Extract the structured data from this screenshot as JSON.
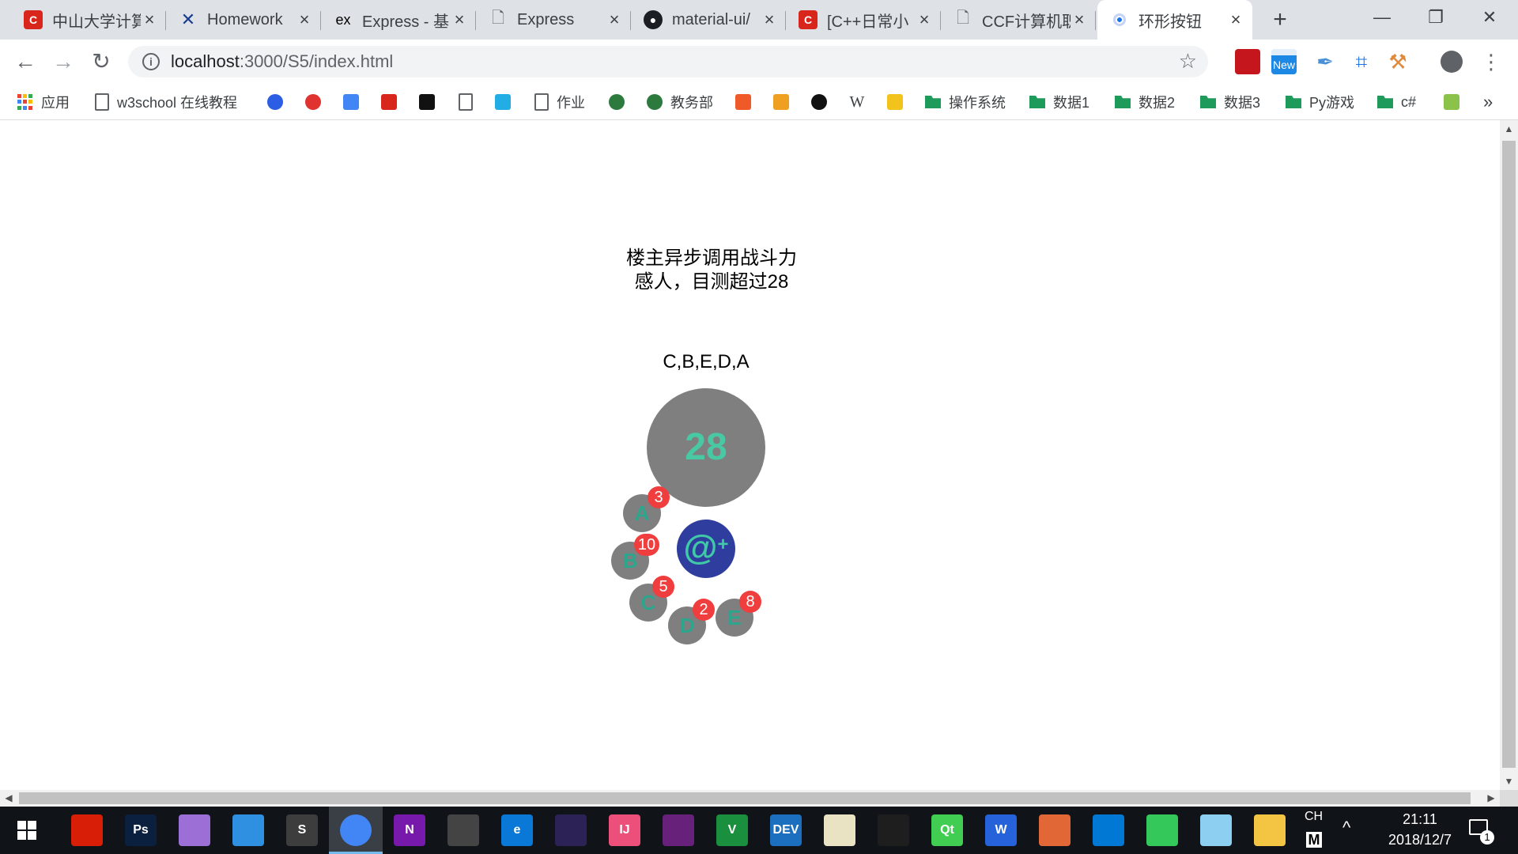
{
  "browser": {
    "tabs": [
      {
        "title": "中山大学计算",
        "icon": "csdn-icon",
        "active": false
      },
      {
        "title": "Homework",
        "icon": "x-logo-icon",
        "active": false
      },
      {
        "title": "Express - 基",
        "icon": "express-icon",
        "active": false
      },
      {
        "title": "Express",
        "icon": "document-icon",
        "active": false
      },
      {
        "title": "material-ui/",
        "icon": "github-icon",
        "active": false
      },
      {
        "title": "[C++日常小",
        "icon": "csdn-icon",
        "active": false
      },
      {
        "title": "CCF计算机职",
        "icon": "document-icon",
        "active": false
      },
      {
        "title": "环形按钮",
        "icon": "loading-dot-icon",
        "active": true
      }
    ],
    "new_tab": "+",
    "window_controls": {
      "minimize": "—",
      "restore": "❐",
      "close": "✕"
    },
    "address": {
      "host": "localhost",
      "rest": ":3000/S5/index.html"
    },
    "extensions": [
      {
        "name": "pdf-extension-icon",
        "color": "#c4161c"
      },
      {
        "name": "new-badge-extension-icon",
        "label": "New",
        "color": "#1e88e5"
      },
      {
        "name": "eyedropper-extension-icon",
        "color": "#4a90d9"
      },
      {
        "name": "crop-extension-icon",
        "color": "#1a73e8"
      },
      {
        "name": "tool-extension-icon",
        "color": "#e0893a"
      },
      {
        "name": "account-icon",
        "color": "#5f6368"
      },
      {
        "name": "menu-icon",
        "color": "#5f6368"
      }
    ],
    "bookmarks": [
      {
        "label": "应用",
        "icon": "apps-icon"
      },
      {
        "label": "w3school 在线教程",
        "icon": "document-icon"
      },
      {
        "label": "",
        "icon": "baidu-icon",
        "color": "#2b5ee5"
      },
      {
        "label": "",
        "icon": "weibo-icon",
        "color": "#e0322e"
      },
      {
        "label": "",
        "icon": "translate-icon",
        "color": "#4285f4"
      },
      {
        "label": "",
        "icon": "csdn-icon",
        "color": "#d9261c"
      },
      {
        "label": "",
        "icon": "segmentfault-icon",
        "color": "#111111"
      },
      {
        "label": "",
        "icon": "document-icon",
        "color": "#ffffff"
      },
      {
        "label": "",
        "icon": "bilibili-icon",
        "color": "#23ade5"
      },
      {
        "label": "作业",
        "icon": "document-icon"
      },
      {
        "label": "",
        "icon": "sysu-icon",
        "color": "#2d7a3f"
      },
      {
        "label": "教务部",
        "icon": "sysu-icon"
      },
      {
        "label": "",
        "icon": "orange-app-icon",
        "color": "#f05a28"
      },
      {
        "label": "",
        "icon": "leetcode-icon",
        "color": "#f0a020"
      },
      {
        "label": "",
        "icon": "github-icon",
        "color": "#111111"
      },
      {
        "label": "",
        "icon": "wikipedia-icon",
        "color": "#ffffff"
      },
      {
        "label": "",
        "icon": "smiley-icon",
        "color": "#f2c31a"
      },
      {
        "label": "操作系统",
        "icon": "folder-icon"
      },
      {
        "label": "数据1",
        "icon": "folder-icon"
      },
      {
        "label": "数据2",
        "icon": "folder-icon"
      },
      {
        "label": "数据3",
        "icon": "folder-icon"
      },
      {
        "label": "Py游戏",
        "icon": "folder-icon"
      },
      {
        "label": "c#",
        "icon": "folder-icon"
      },
      {
        "label": "",
        "icon": "leaf-app-icon",
        "color": "#8bc34a"
      }
    ],
    "bookmarks_overflow": "»"
  },
  "page": {
    "info_line1": "楼主异步调用战斗力",
    "info_line2": "感人，目测超过28",
    "sequence": "C,B,E,D,A",
    "total": "28",
    "at_button": {
      "symbol": "@",
      "plus": "+"
    },
    "buttons": [
      {
        "letter": "A",
        "badge": "3"
      },
      {
        "letter": "B",
        "badge": "10"
      },
      {
        "letter": "C",
        "badge": "5"
      },
      {
        "letter": "D",
        "badge": "2"
      },
      {
        "letter": "E",
        "badge": "8"
      }
    ],
    "colors": {
      "circle_bg": "#7f7f7f",
      "number_text": "#48c9a4",
      "badge_bg": "#f03d3d",
      "at_button_bg": "#2f3d9e",
      "letter_text": "#2ca58d"
    }
  },
  "taskbar": {
    "apps": [
      {
        "name": "netease-music-icon",
        "color": "#d81e06"
      },
      {
        "name": "photoshop-icon",
        "label": "Ps",
        "color": "#0b1f3f"
      },
      {
        "name": "paint-icon",
        "color": "#9b6fd6"
      },
      {
        "name": "bird-app-icon",
        "color": "#2f8fe0"
      },
      {
        "name": "sublime-text-icon",
        "label": "S",
        "color": "#3d3d3d"
      },
      {
        "name": "chrome-icon",
        "color": "#4285f4"
      },
      {
        "name": "onenote-icon",
        "label": "N",
        "color": "#7719aa"
      },
      {
        "name": "calculator-icon",
        "color": "#444444"
      },
      {
        "name": "edge-icon",
        "label": "e",
        "color": "#0a78d7"
      },
      {
        "name": "eclipse-icon",
        "color": "#2c2255"
      },
      {
        "name": "intellij-icon",
        "label": "IJ",
        "color": "#ec4f7a"
      },
      {
        "name": "visual-studio-icon",
        "color": "#68217a"
      },
      {
        "name": "vim-icon",
        "label": "V",
        "color": "#1a8f3e"
      },
      {
        "name": "devcpp-icon",
        "label": "DEV",
        "color": "#1c6fbf"
      },
      {
        "name": "notepad-icon",
        "color": "#e9e3c4"
      },
      {
        "name": "terminal-icon",
        "color": "#1e1e1e"
      },
      {
        "name": "qt-icon",
        "label": "Qt",
        "color": "#41cd52"
      },
      {
        "name": "wps-icon",
        "label": "W",
        "color": "#2662d9"
      },
      {
        "name": "matlab-icon",
        "color": "#e16737"
      },
      {
        "name": "vscode-icon",
        "color": "#0078d4"
      },
      {
        "name": "spinner-app-icon",
        "color": "#34c759"
      },
      {
        "name": "typora-icon",
        "color": "#8ccff0"
      },
      {
        "name": "file-explorer-icon",
        "color": "#f4c542"
      }
    ],
    "ime": "CH",
    "ime_mode": "M",
    "tray_chevron": "^",
    "time": "21:11",
    "date": "2018/12/7",
    "notification_count": "1"
  }
}
